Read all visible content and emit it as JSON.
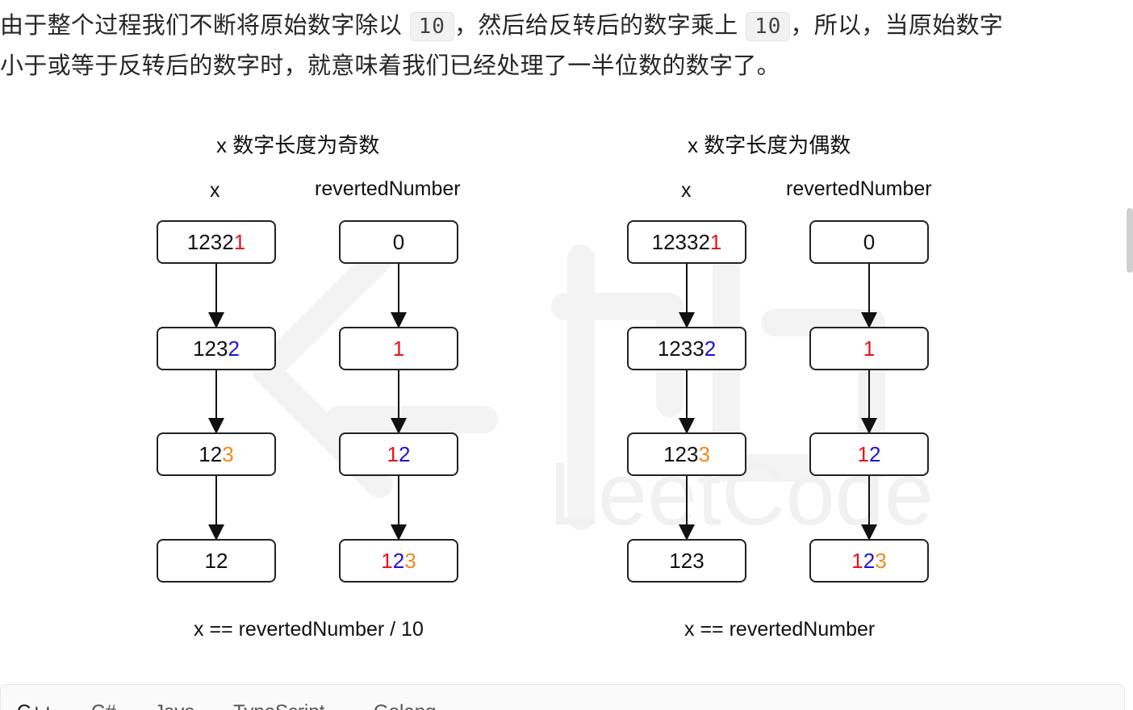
{
  "paragraph": {
    "line1_a": "由于整个过程我们不断将原始数字除以",
    "line1_code1": "10",
    "line1_b": "，然后给反转后的数字乘上",
    "line1_code2": "10",
    "line1_c": "，所以，当原始数字",
    "line2": "小于或等于反转后的数字时，就意味着我们已经处理了一半位数的数字了。"
  },
  "figure": {
    "watermark_text": "LeetCode",
    "left": {
      "title": "x 数字长度为奇数",
      "label_x": "x",
      "label_rev": "revertedNumber",
      "x_nodes": [
        {
          "plain": "1232",
          "colored": "1",
          "color": "#e8121c"
        },
        {
          "plain": "123",
          "colored": "2",
          "color": "#2010e0"
        },
        {
          "plain": "12",
          "colored": "3",
          "color": "#f28a1a"
        },
        {
          "plain": "12",
          "colored": "",
          "color": ""
        }
      ],
      "rev_nodes": [
        [
          {
            "t": "0",
            "c": "#111111"
          }
        ],
        [
          {
            "t": "1",
            "c": "#e8121c"
          }
        ],
        [
          {
            "t": "1",
            "c": "#e8121c"
          },
          {
            "t": "2",
            "c": "#2010e0"
          }
        ],
        [
          {
            "t": "1",
            "c": "#e8121c"
          },
          {
            "t": "2",
            "c": "#2010e0"
          },
          {
            "t": "3",
            "c": "#f28a1a"
          }
        ]
      ],
      "equation": "x == revertedNumber / 10"
    },
    "right": {
      "title": "x 数字长度为偶数",
      "label_x": "x",
      "label_rev": "revertedNumber",
      "x_nodes": [
        {
          "plain": "12332",
          "colored": "1",
          "color": "#e8121c"
        },
        {
          "plain": "1233",
          "colored": "2",
          "color": "#2010e0"
        },
        {
          "plain": "123",
          "colored": "3",
          "color": "#f28a1a"
        },
        {
          "plain": "123",
          "colored": "",
          "color": ""
        }
      ],
      "rev_nodes": [
        [
          {
            "t": "0",
            "c": "#111111"
          }
        ],
        [
          {
            "t": "1",
            "c": "#e8121c"
          }
        ],
        [
          {
            "t": "1",
            "c": "#e8121c"
          },
          {
            "t": "2",
            "c": "#2010e0"
          }
        ],
        [
          {
            "t": "1",
            "c": "#e8121c"
          },
          {
            "t": "2",
            "c": "#2010e0"
          },
          {
            "t": "3",
            "c": "#f28a1a"
          }
        ]
      ],
      "equation": "x == revertedNumber"
    }
  },
  "code_tabs": [
    "C++",
    "C#",
    "Java",
    "TypeScript",
    "Golang"
  ]
}
